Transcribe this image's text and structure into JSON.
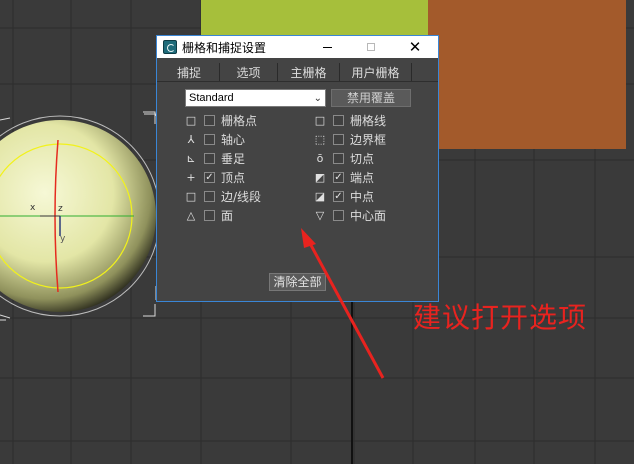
{
  "window": {
    "title": "栅格和捕捉设置",
    "close_glyph": "✕"
  },
  "tabs": [
    {
      "label": "捕捉"
    },
    {
      "label": "选项"
    },
    {
      "label": "主栅格"
    },
    {
      "label": "用户栅格"
    }
  ],
  "dropdown": {
    "value": "Standard",
    "arrow": "⌄"
  },
  "override_button": {
    "label": "禁用覆盖"
  },
  "snap_options": {
    "left": [
      {
        "label": "栅格点",
        "checked": false,
        "symbol": "□"
      },
      {
        "label": "轴心",
        "checked": false,
        "symbol": "⅄"
      },
      {
        "label": "垂足",
        "checked": false,
        "symbol": "⊾"
      },
      {
        "label": "顶点",
        "checked": true,
        "symbol": "+"
      },
      {
        "label": "边/线段",
        "checked": false,
        "symbol": "□"
      },
      {
        "label": "面",
        "checked": false,
        "symbol": "△"
      }
    ],
    "right": [
      {
        "label": "栅格线",
        "checked": false,
        "symbol": "□"
      },
      {
        "label": "边界框",
        "checked": false,
        "symbol": "⬚"
      },
      {
        "label": "切点",
        "checked": false,
        "symbol": "ō"
      },
      {
        "label": "端点",
        "checked": true,
        "symbol": "◩"
      },
      {
        "label": "中点",
        "checked": true,
        "symbol": "◪"
      },
      {
        "label": "中心面",
        "checked": false,
        "symbol": "▽"
      }
    ]
  },
  "clear_button": {
    "label": "清除全部"
  },
  "viewport": {
    "axis_x": "x",
    "axis_y": "y",
    "axis_z": "z"
  },
  "annotation": {
    "text": "建议打开选项",
    "color": "#e8231f"
  },
  "colors": {
    "viewport_bg": "#3a3a3a",
    "dialog_bg": "#444444",
    "green_object": "#a6bf3b",
    "orange_object": "#a35a2b",
    "sphere": "#e9ecb4"
  }
}
